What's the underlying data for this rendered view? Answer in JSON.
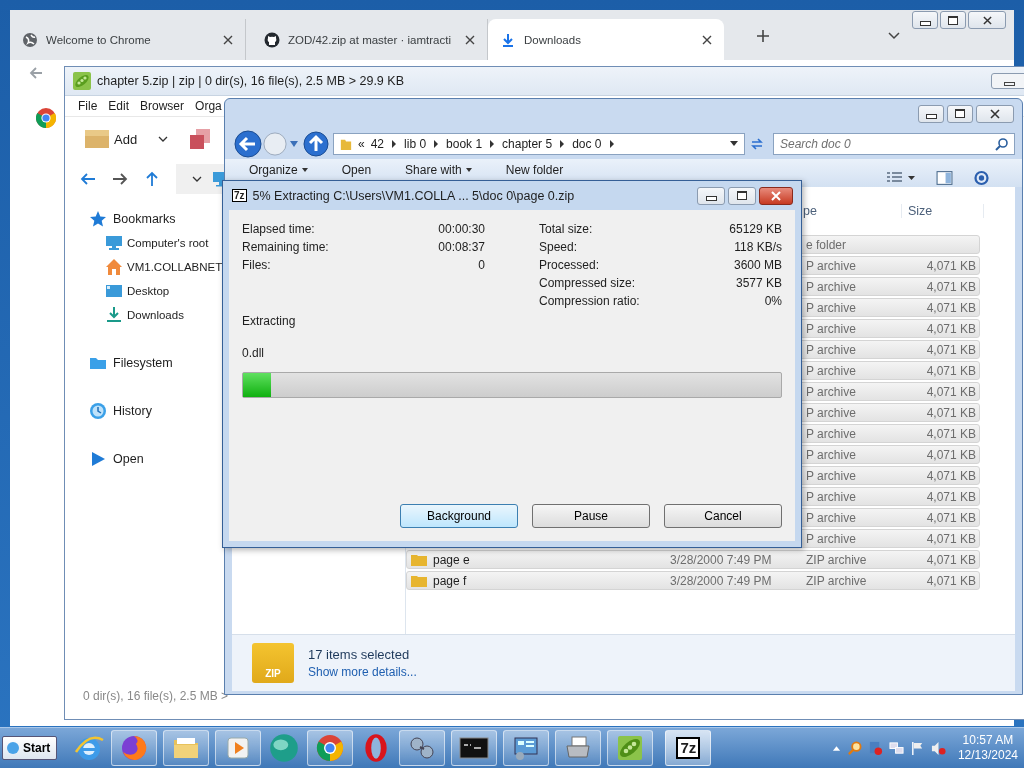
{
  "browser": {
    "tabs": [
      {
        "title": "Welcome to Chrome",
        "selected": false
      },
      {
        "title": "ZOD/42.zip at master · iamtracti",
        "selected": false
      },
      {
        "title": "Downloads",
        "selected": true
      }
    ]
  },
  "peazip": {
    "title": "chapter 5.zip | zip | 0 dir(s), 16 file(s), 2.5 MB > 29.9 KB",
    "menu": [
      "File",
      "Edit",
      "Browser",
      "Orga"
    ],
    "add_label": "Add",
    "sidebar": [
      {
        "label": "Bookmarks",
        "children": [
          {
            "label": "Computer's root"
          },
          {
            "label": "VM1.COLLABNET"
          },
          {
            "label": "Desktop"
          },
          {
            "label": "Downloads"
          }
        ]
      },
      {
        "label": "Filesystem"
      },
      {
        "label": "History"
      },
      {
        "label": "Open"
      }
    ],
    "status": "0 dir(s), 16 file(s), 2.5 MB >"
  },
  "explorer": {
    "breadcrumb_lead": "«",
    "breadcrumb": [
      "42",
      "lib 0",
      "book 1",
      "chapter 5",
      "doc 0"
    ],
    "search": {
      "placeholder": "Search doc 0"
    },
    "toolbar": [
      "Organize",
      "Open",
      "Share with",
      "New folder"
    ],
    "columns": [
      "pe",
      "Size"
    ],
    "rows": [
      {
        "type": "e folder",
        "selected": true
      },
      {
        "type": "P archive",
        "size": "4,071 KB",
        "selected": true
      },
      {
        "type": "P archive",
        "size": "4,071 KB",
        "selected": true
      },
      {
        "type": "P archive",
        "size": "4,071 KB",
        "selected": true
      },
      {
        "type": "P archive",
        "size": "4,071 KB",
        "selected": true
      },
      {
        "type": "P archive",
        "size": "4,071 KB",
        "selected": true
      },
      {
        "type": "P archive",
        "size": "4,071 KB",
        "selected": true
      },
      {
        "type": "P archive",
        "size": "4,071 KB",
        "selected": true
      },
      {
        "type": "P archive",
        "size": "4,071 KB",
        "selected": true
      },
      {
        "type": "P archive",
        "size": "4,071 KB",
        "selected": true
      },
      {
        "type": "P archive",
        "size": "4,071 KB",
        "selected": true
      },
      {
        "type": "P archive",
        "size": "4,071 KB",
        "selected": true
      },
      {
        "type": "P archive",
        "size": "4,071 KB",
        "selected": true
      },
      {
        "type": "P archive",
        "size": "4,071 KB",
        "selected": true
      },
      {
        "type": "P archive",
        "size": "4,071 KB",
        "selected": true
      },
      {
        "name": "page e",
        "date": "3/28/2000 7:49 PM",
        "type": "ZIP archive",
        "size": "4,071 KB",
        "selected": true
      },
      {
        "name": "page f",
        "date": "3/28/2000 7:49 PM",
        "type": "ZIP archive",
        "size": "4,071 KB",
        "selected": true
      }
    ],
    "details": {
      "icon_label": "ZIP",
      "count": "17 items selected",
      "link": "Show more details..."
    }
  },
  "dialog": {
    "icon_label": "7z",
    "title": "5% Extracting C:\\Users\\VM1.COLLA ... 5\\doc 0\\page 0.zip",
    "stats_left": [
      {
        "label": "Elapsed time:",
        "value": "00:00:30"
      },
      {
        "label": "Remaining time:",
        "value": "00:08:37"
      },
      {
        "label": "Files:",
        "value": "0"
      }
    ],
    "stats_right": [
      {
        "label": "Total size:",
        "value": "65129 KB"
      },
      {
        "label": "Speed:",
        "value": "118 KB/s"
      },
      {
        "label": "Processed:",
        "value": "3600 MB"
      },
      {
        "label": "Compressed size:",
        "value": "3577 KB"
      },
      {
        "label": "Compression ratio:",
        "value": "0%"
      }
    ],
    "status": "Extracting",
    "file": "0.dll",
    "progress": {
      "level": 0.052
    },
    "buttons": [
      {
        "label": "Background",
        "focused": true
      },
      {
        "label": "Pause",
        "focused": false
      },
      {
        "label": "Cancel",
        "focused": false
      }
    ]
  },
  "taskbar": {
    "start": "Start",
    "app_label": "7z",
    "clock": {
      "time": "10:57 AM",
      "date": "12/13/2024"
    }
  }
}
